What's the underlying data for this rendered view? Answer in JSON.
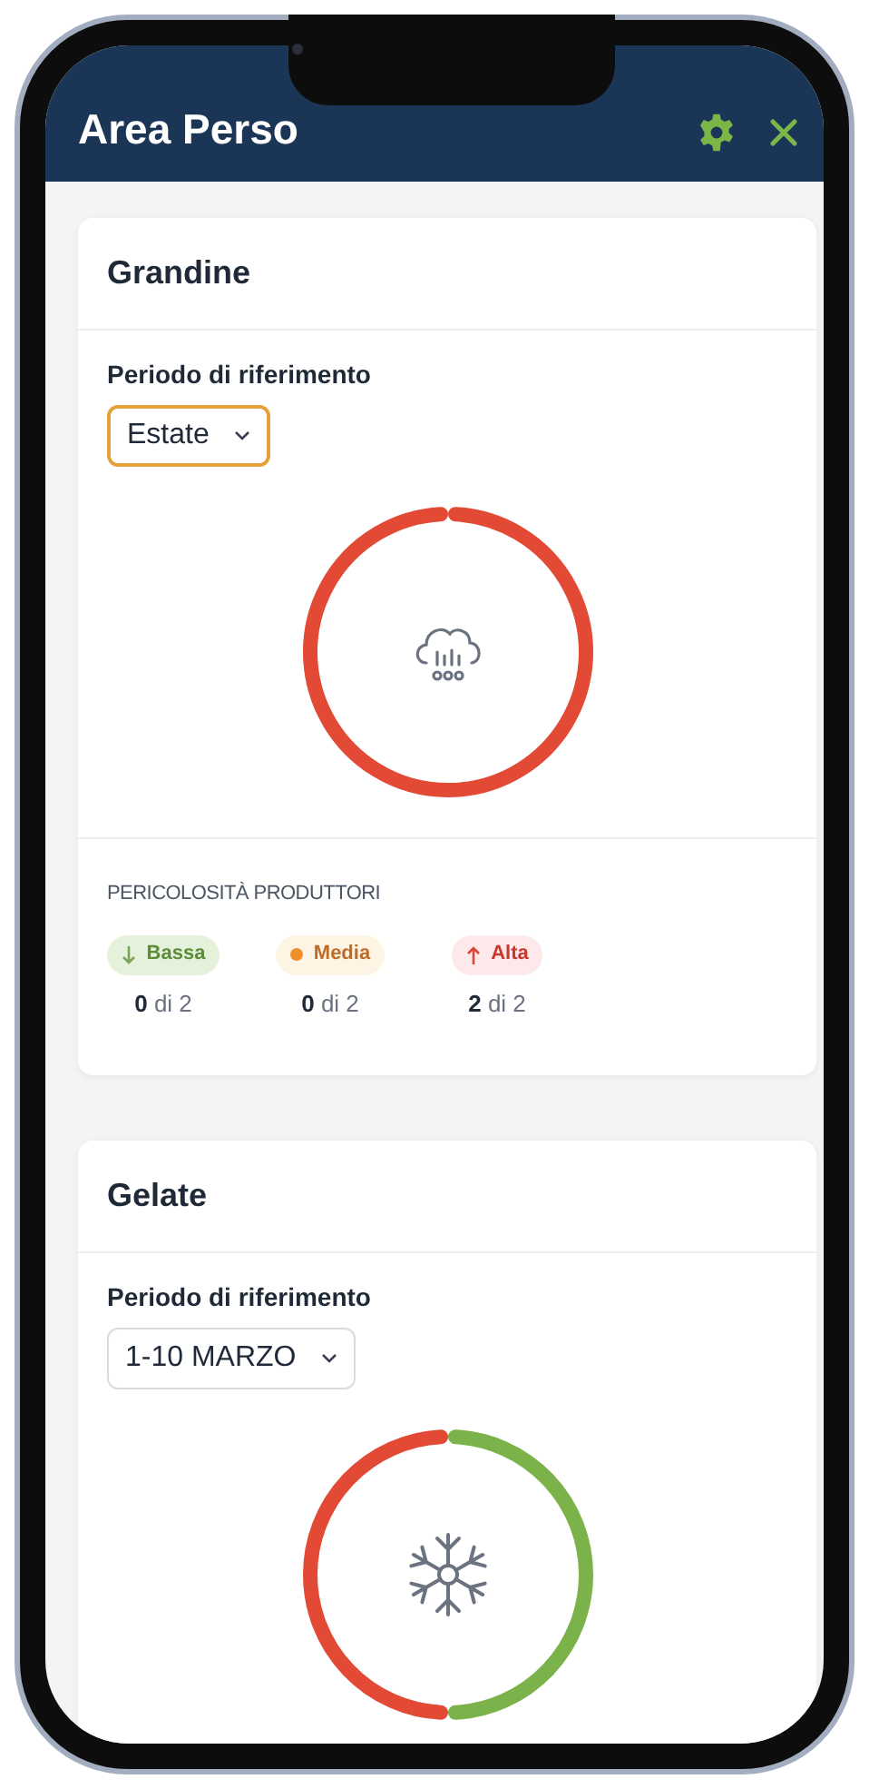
{
  "header": {
    "title": "Area Perso"
  },
  "cards": [
    {
      "title": "Grandine",
      "period_label": "Periodo di riferimento",
      "period_value": "Estate",
      "focused": true,
      "kind": "hail",
      "ring": [
        {
          "color": "#e24a35",
          "level": 1
        }
      ],
      "danger": {
        "title": "PERICOLOSITÀ PRODUTTORI",
        "levels": [
          {
            "kind": "low",
            "label": "Bassa",
            "count": "0",
            "total": "di 2"
          },
          {
            "kind": "medium",
            "label": "Media",
            "count": "0",
            "total": "di 2"
          },
          {
            "kind": "high",
            "label": "Alta",
            "count": "2",
            "total": "di 2"
          }
        ]
      }
    },
    {
      "title": "Gelate",
      "period_label": "Periodo di riferimento",
      "period_value": "1-10 MARZO",
      "focused": false,
      "kind": "frost",
      "ring": [
        {
          "color": "#7bb24a",
          "level": 0.5
        },
        {
          "color": "#e24a35",
          "level": 0.5
        }
      ]
    }
  ]
}
